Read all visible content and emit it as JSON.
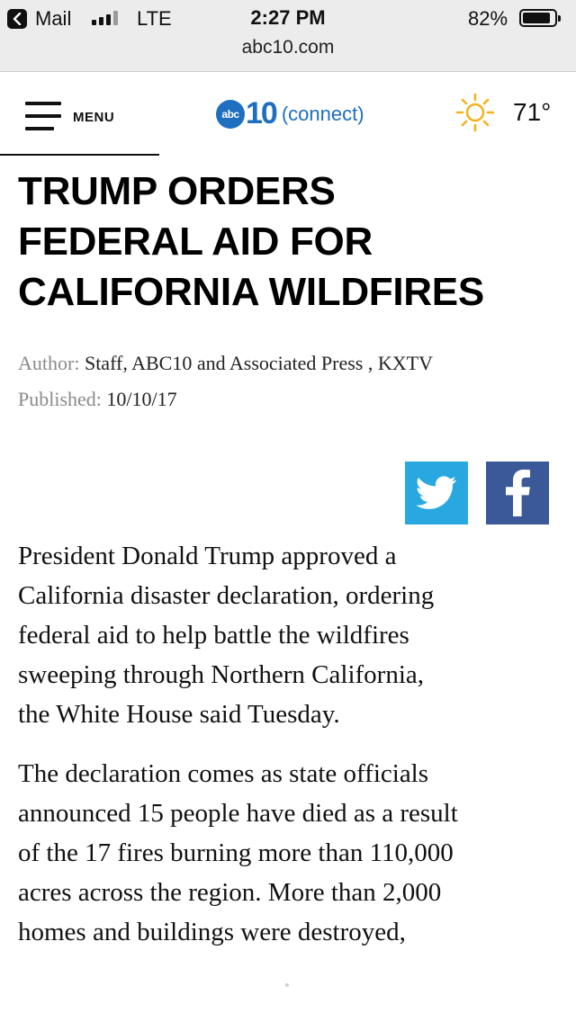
{
  "status_bar": {
    "back_app": "Mail",
    "network": "LTE",
    "time": "2:27 PM",
    "battery_percent": "82%",
    "battery_level": 0.82
  },
  "browser": {
    "url": "abc10.com"
  },
  "site_header": {
    "menu_label": "MENU",
    "logo": {
      "abc": "abc",
      "number": "10",
      "tagline": "(connect)"
    },
    "weather": {
      "icon": "sun-icon",
      "temperature": "71°"
    },
    "brand_color": "#1e6fc0"
  },
  "article": {
    "headline_lines": [
      "TRUMP ORDERS",
      "FEDERAL AID FOR",
      "CALIFORNIA WILDFIRES"
    ],
    "author_label": "Author:",
    "author": "Staff, ABC10 and Associated Press , KXTV",
    "published_label": "Published:",
    "published": "10/10/17",
    "share": [
      {
        "network": "twitter",
        "icon": "twitter-bird-icon",
        "color": "#29a8e0"
      },
      {
        "network": "facebook",
        "icon": "facebook-f-icon",
        "color": "#3b5998"
      }
    ],
    "paragraphs": [
      [
        "President Donald Trump approved a",
        "California disaster declaration, ordering",
        "federal aid to help battle the wildfires",
        "sweeping through Northern California,",
        "the White House said Tuesday."
      ],
      [
        "The declaration comes as state officials",
        "announced 15 people have died as a result",
        "of the 17 fires burning more than 110,000",
        "acres across the region. More than 2,000",
        "homes and buildings were destroyed,"
      ]
    ]
  }
}
